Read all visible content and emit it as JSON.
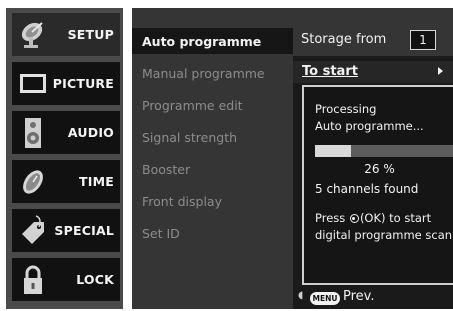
{
  "left_menu": {
    "items": [
      {
        "label": "SETUP",
        "icon": "satellite-dish-icon",
        "selected": true
      },
      {
        "label": "PICTURE",
        "icon": "monitor-icon",
        "selected": false
      },
      {
        "label": "AUDIO",
        "icon": "speaker-icon",
        "selected": false
      },
      {
        "label": "TIME",
        "icon": "clock-icon",
        "selected": false
      },
      {
        "label": "SPECIAL",
        "icon": "tag-icon",
        "selected": false
      },
      {
        "label": "LOCK",
        "icon": "padlock-icon",
        "selected": false
      }
    ]
  },
  "sub_menu": {
    "items": [
      {
        "label": "Auto programme",
        "selected": true
      },
      {
        "label": "Manual programme",
        "selected": false
      },
      {
        "label": "Programme edit",
        "selected": false
      },
      {
        "label": "Signal strength",
        "selected": false
      },
      {
        "label": "Booster",
        "selected": false
      },
      {
        "label": "Front display",
        "selected": false
      },
      {
        "label": "Set ID",
        "selected": false
      }
    ]
  },
  "right_panel": {
    "storage_label": "Storage from",
    "storage_value": "1",
    "start_label": "To start",
    "dialog": {
      "line1": "Processing",
      "line2": "Auto programme...",
      "progress_percent": 26,
      "percent_text": "26 %",
      "channels_text": "5 channels found",
      "press_text": "Press",
      "ok_text": "(OK) to start",
      "press_line2": "digital programme scan"
    },
    "footer": {
      "menu_button": "MENU",
      "prev_label": "Prev."
    }
  },
  "colors": {
    "menu_bg": "#4a4a4a",
    "item_bg": "#111111",
    "submenu_bg": "#353535",
    "selected_bg": "#161616",
    "dim_text": "#8c8c8c",
    "text": "#f2f2f2"
  }
}
